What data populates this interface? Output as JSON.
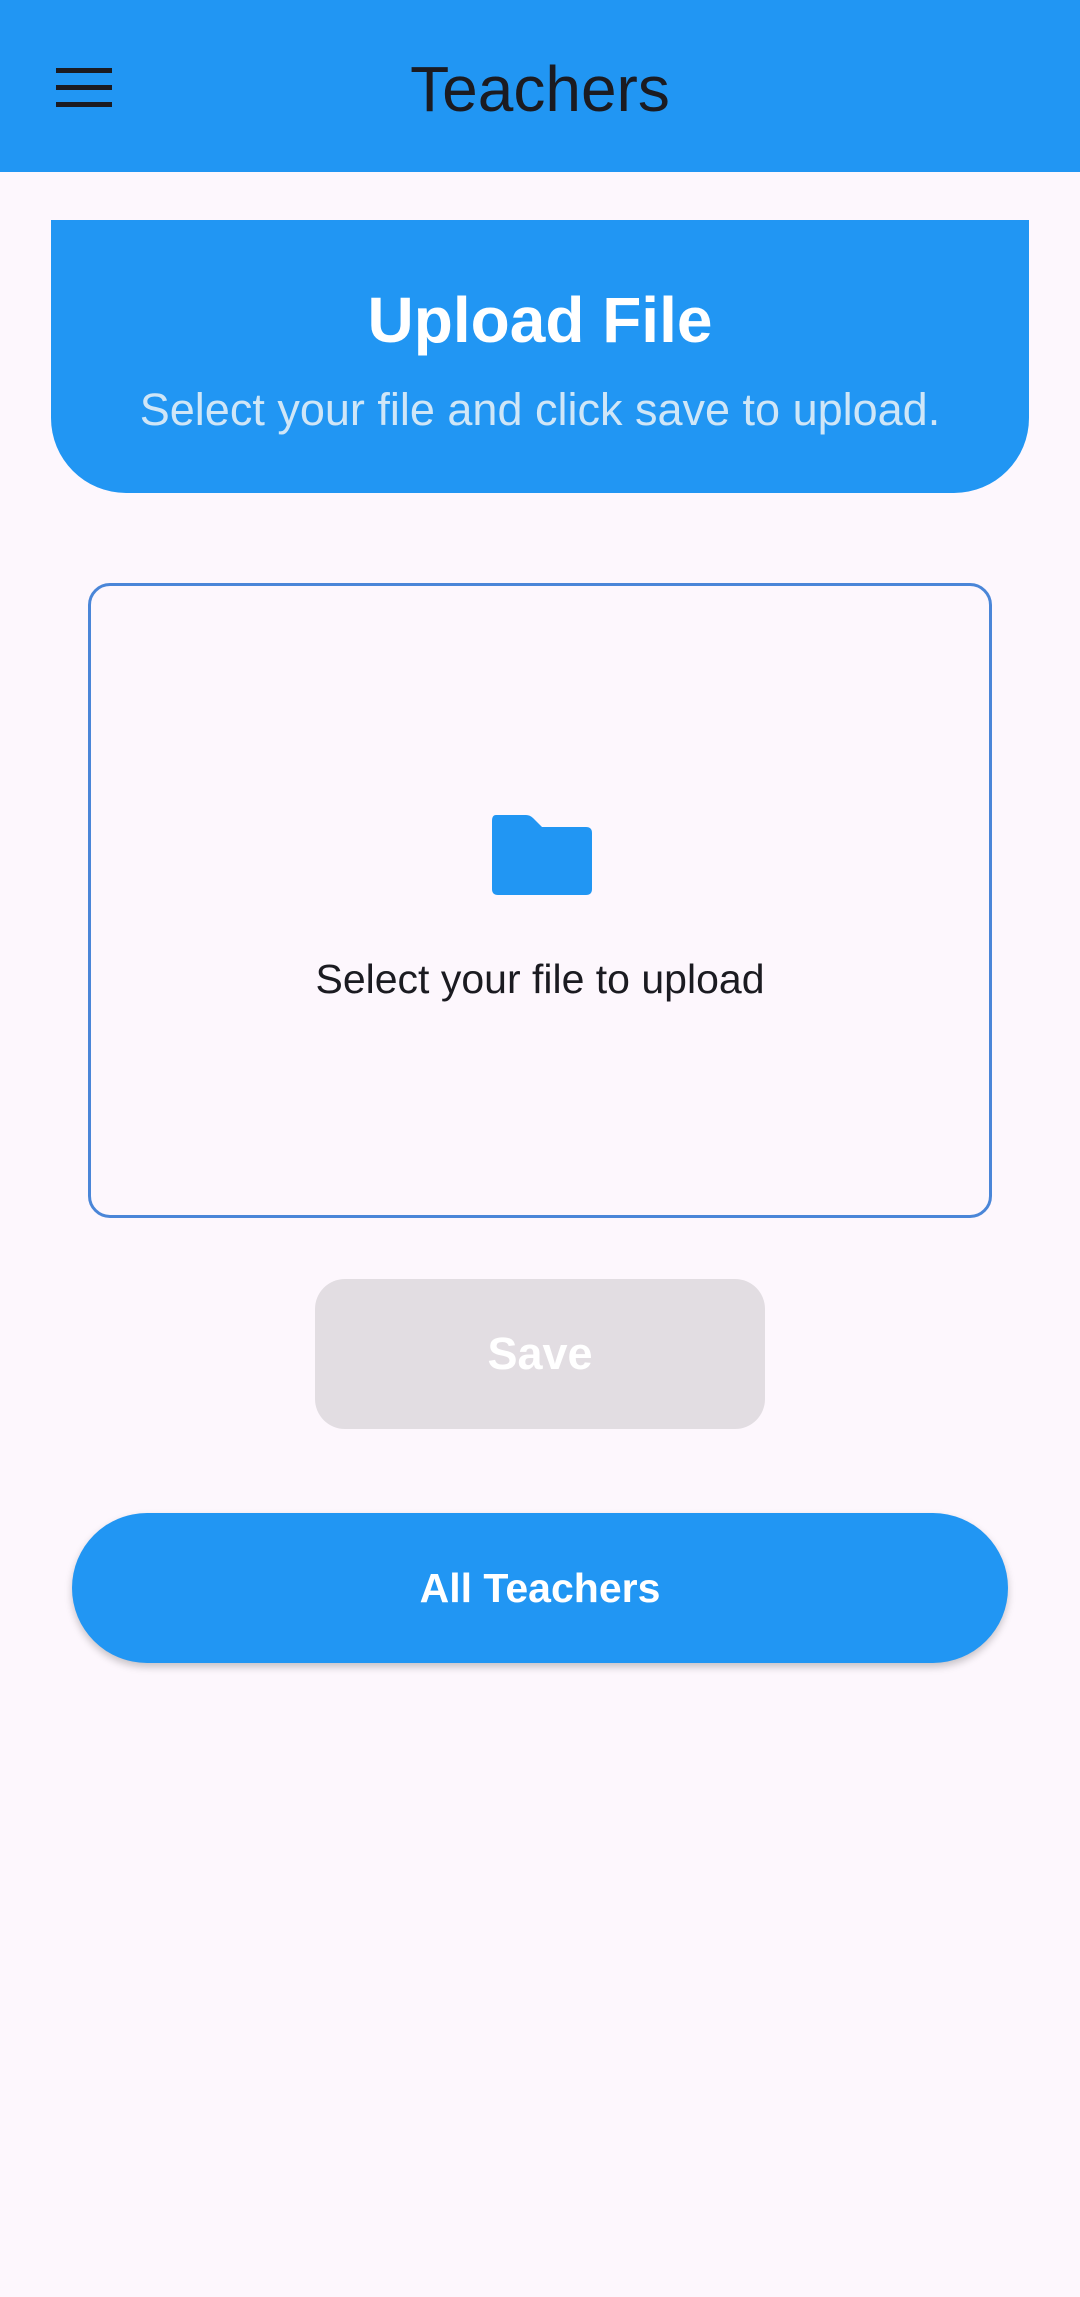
{
  "appbar": {
    "title": "Teachers",
    "menu_icon": "menu-icon"
  },
  "header": {
    "title": "Upload File",
    "subtitle": "Select your file and click save to upload."
  },
  "upload": {
    "icon": "folder-icon",
    "label": "Select your file to upload"
  },
  "actions": {
    "save_label": "Save",
    "all_teachers_label": "All Teachers"
  },
  "colors": {
    "primary": "#2196F3",
    "background": "#FDF7FD",
    "upload_border": "#4A86D8",
    "disabled_button": "#E2DDE2",
    "text_dark": "#1B1B21",
    "subtitle": "#CFE6F7"
  }
}
